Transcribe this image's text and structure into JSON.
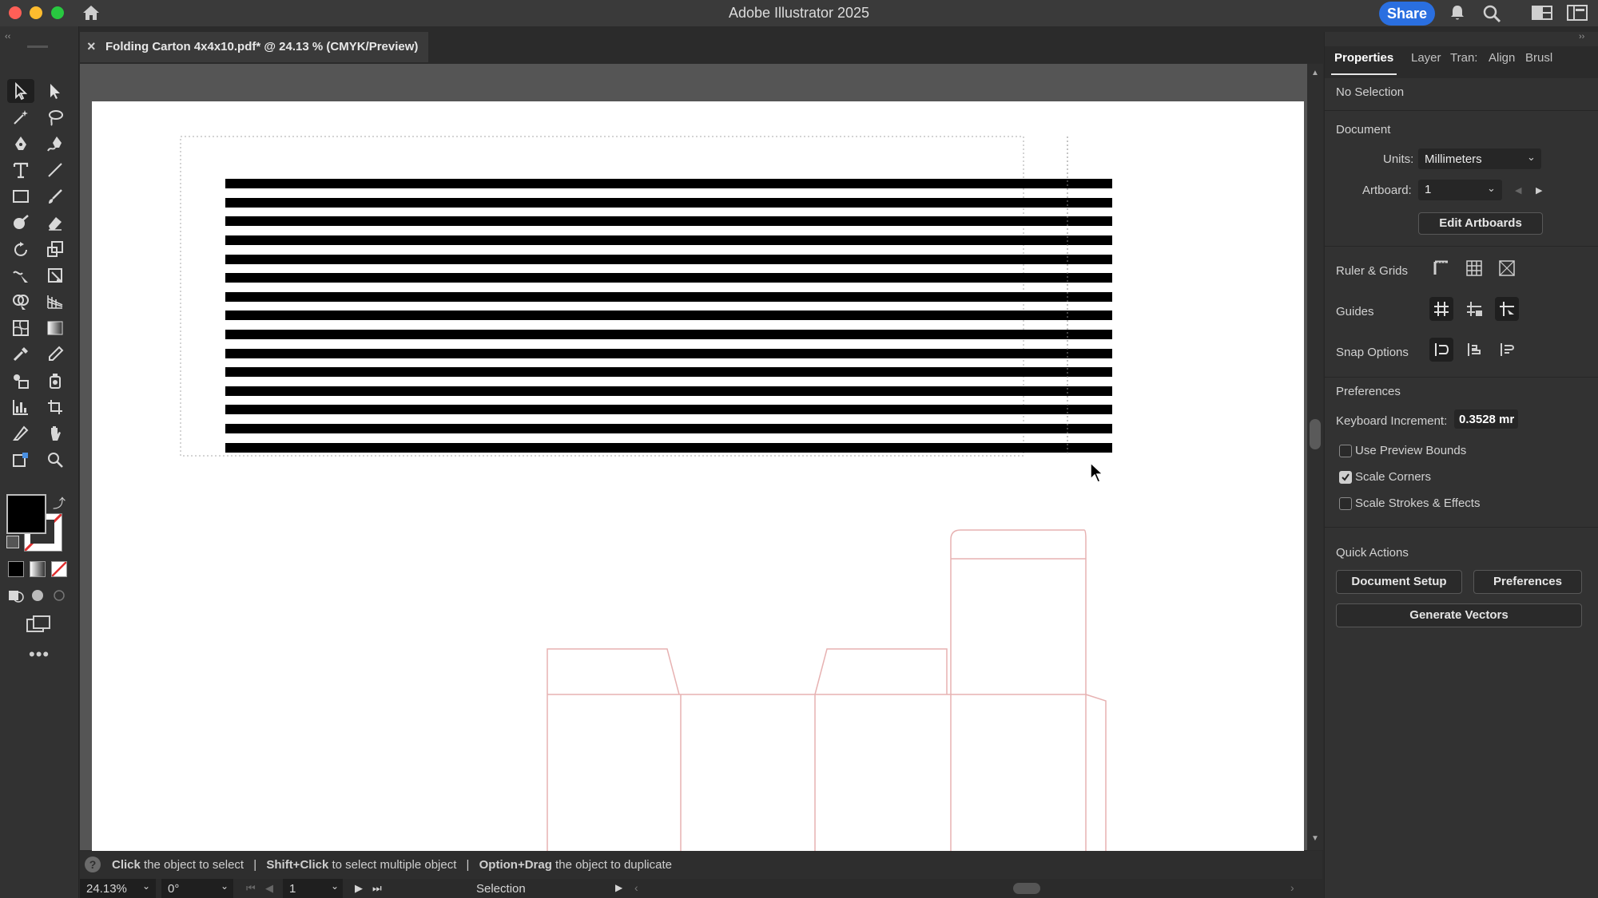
{
  "app": {
    "title": "Adobe Illustrator 2025",
    "share_label": "Share"
  },
  "document_tab": {
    "title": "Folding Carton 4x4x10.pdf* @ 24.13 % (CMYK/Preview)",
    "close_symbol": "×"
  },
  "panel": {
    "tabs": [
      "Properties",
      "Layer",
      "Tran:",
      "Align",
      "Brusl"
    ],
    "selection_status": "No Selection",
    "document_heading": "Document",
    "units_label": "Units:",
    "units_value": "Millimeters",
    "artboard_label": "Artboard:",
    "artboard_value": "1",
    "edit_artboards": "Edit Artboards",
    "ruler_grids": "Ruler & Grids",
    "guides": "Guides",
    "snap_options": "Snap Options",
    "preferences_heading": "Preferences",
    "keyboard_increment_label": "Keyboard Increment:",
    "keyboard_increment_value": "0.3528 mr",
    "checkboxes": [
      {
        "label": "Use Preview Bounds",
        "checked": false
      },
      {
        "label": "Scale Corners",
        "checked": true
      },
      {
        "label": "Scale Strokes & Effects",
        "checked": false
      }
    ],
    "quick_actions_heading": "Quick Actions",
    "document_setup": "Document Setup",
    "preferences_button": "Preferences",
    "generate_vectors": "Generate Vectors"
  },
  "status": {
    "help_symbol": "?",
    "hint_parts": [
      {
        "bold": "Click",
        "text": " the object to select"
      },
      {
        "bold": "Shift+Click",
        "text": " to select multiple object"
      },
      {
        "bold": "Option+Drag",
        "text": " the object to duplicate"
      }
    ],
    "separator": "|"
  },
  "bottom": {
    "zoom": "24.13%",
    "rotation": "0°",
    "artboard_number": "1",
    "tool_name": "Selection"
  },
  "colors": {
    "accent": "#2a6fe0",
    "close": "#ff5f57",
    "minimize": "#febc2e",
    "maximize": "#28c840",
    "dieline": "#e7b2b2",
    "fill": "#000000"
  },
  "icons": [
    "home-icon",
    "bell-icon",
    "search-icon",
    "workspace-icon",
    "panel-toggle-icon",
    "cursor-arrow-icon"
  ]
}
